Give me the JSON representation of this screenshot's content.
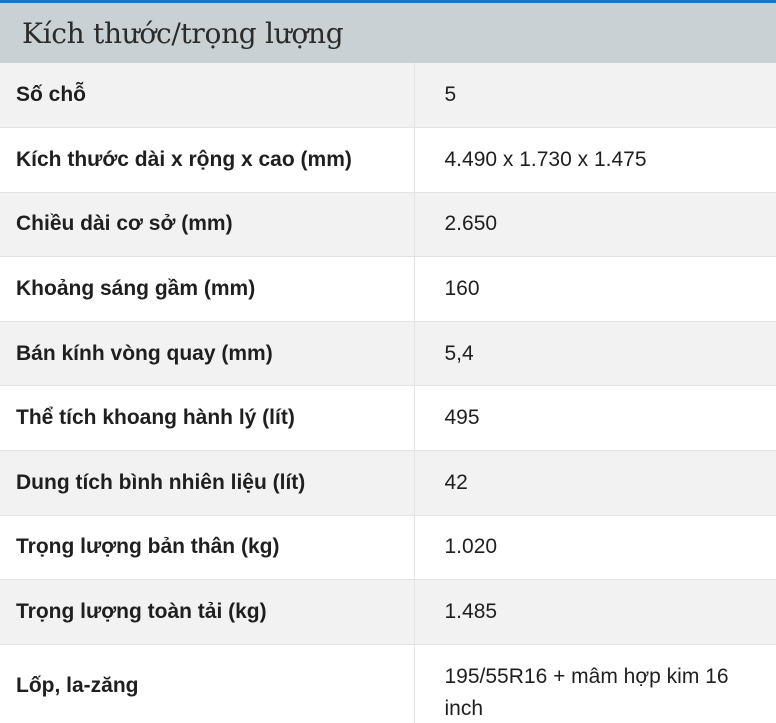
{
  "section": {
    "title": "Kích thước/trọng lượng"
  },
  "rows": [
    {
      "label": "Số chỗ",
      "value": "5"
    },
    {
      "label": "Kích thước dài x rộng x cao (mm)",
      "value": "4.490 x 1.730 x 1.475"
    },
    {
      "label": "Chiều dài cơ sở (mm)",
      "value": "2.650"
    },
    {
      "label": "Khoảng sáng gầm (mm)",
      "value": "160"
    },
    {
      "label": "Bán kính vòng quay (mm)",
      "value": "5,4"
    },
    {
      "label": "Thể tích khoang hành lý (lít)",
      "value": "495"
    },
    {
      "label": "Dung tích bình nhiên liệu (lít)",
      "value": "42"
    },
    {
      "label": "Trọng lượng bản thân (kg)",
      "value": "1.020"
    },
    {
      "label": "Trọng lượng toàn tải (kg)",
      "value": "1.485"
    },
    {
      "label": "Lốp, la-zăng",
      "value": "195/55R16 + mâm hợp kim 16 inch"
    }
  ],
  "colors": {
    "accent_border": "#1e73be",
    "header_bg": "#c9d1d5",
    "row_alt_bg": "#f2f2f2"
  }
}
